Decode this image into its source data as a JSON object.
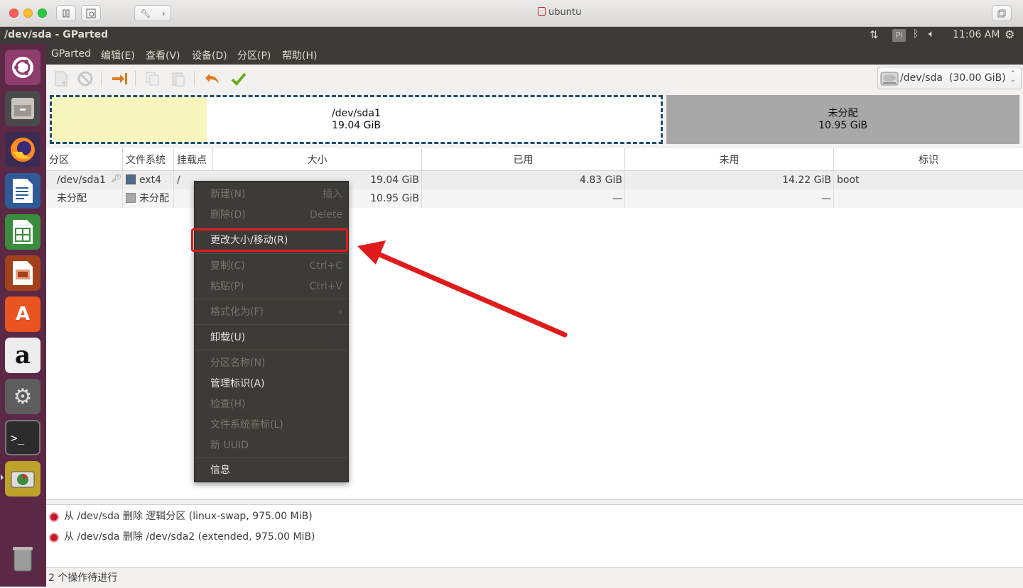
{
  "host": {
    "title": "ubuntu"
  },
  "top_panel": {
    "window_title": "/dev/sda - GParted",
    "time": "11:06 AM",
    "kbd": "Pi"
  },
  "launcher": {
    "items": [
      "ubuntu-dash-icon",
      "files-icon",
      "firefox-icon",
      "writer-icon",
      "calc-icon",
      "impress-icon",
      "software-center-icon",
      "amazon-icon",
      "system-settings-icon",
      "terminal-icon",
      "gparted-icon",
      "trash-icon"
    ]
  },
  "menu": {
    "items": [
      "GParted",
      "编辑(E)",
      "查看(V)",
      "设备(D)",
      "分区(P)",
      "帮助(H)"
    ]
  },
  "device_select": {
    "value": "/dev/sda  (30.00 GiB)"
  },
  "diskmap": {
    "sda1": {
      "name": "/dev/sda1",
      "size": "19.04 GiB",
      "used_fraction": 0.254
    },
    "unalloc": {
      "name": "未分配",
      "size": "10.95 GiB"
    }
  },
  "table": {
    "headers": [
      "分区",
      "文件系统",
      "挂载点",
      "大小",
      "已用",
      "未用",
      "标识"
    ],
    "rows": [
      {
        "partition": "/dev/sda1",
        "fs": "ext4",
        "mount": "/",
        "size": "19.04 GiB",
        "used": "4.83 GiB",
        "unused": "14.22 GiB",
        "flags": "boot",
        "color": "#4d6b8c"
      },
      {
        "partition": "未分配",
        "fs": "未分配",
        "mount": "",
        "size": "10.95 GiB",
        "used": "—",
        "unused": "—",
        "flags": "",
        "color": "#a8a8a8"
      }
    ]
  },
  "context_menu": {
    "new": {
      "label": "新建(N)",
      "accel": "插入"
    },
    "delete": {
      "label": "删除(D)",
      "accel": "Delete"
    },
    "resize": {
      "label": "更改大小/移动(R)"
    },
    "copy": {
      "label": "复制(C)",
      "accel": "Ctrl+C"
    },
    "paste": {
      "label": "粘贴(P)",
      "accel": "Ctrl+V"
    },
    "format": {
      "label": "格式化为(F)",
      "accel": "›"
    },
    "unmount": {
      "label": "卸载(U)"
    },
    "name": {
      "label": "分区名称(N)"
    },
    "flags": {
      "label": "管理标识(A)"
    },
    "check": {
      "label": "检查(H)"
    },
    "label": {
      "label": "文件系统卷标(L)"
    },
    "uuid": {
      "label": "新 UUID"
    },
    "info": {
      "label": "信息"
    }
  },
  "log": {
    "ops": [
      "从 /dev/sda 删除 逻辑分区 (linux-swap, 975.00 MiB)",
      "从 /dev/sda 删除 /dev/sda2 (extended, 975.00 MiB)"
    ]
  },
  "status": {
    "text": "2 个操作待进行"
  },
  "colors": {
    "highlight": "#e01b1b",
    "ubuntu_purple": "#5b2945"
  }
}
